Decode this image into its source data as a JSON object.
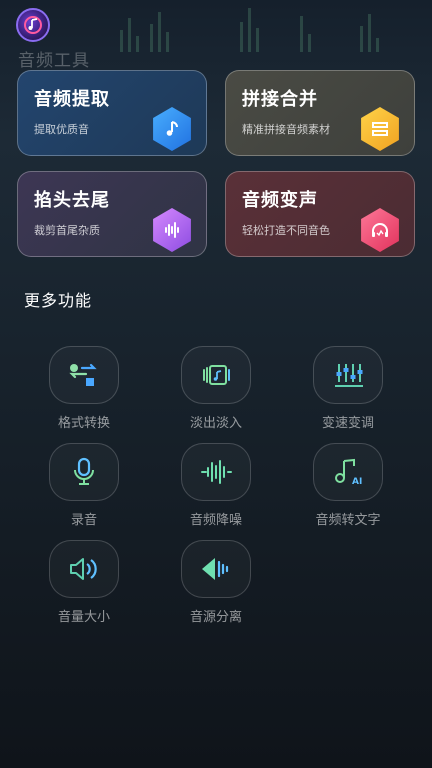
{
  "header": {
    "title": "音频工具",
    "logo_icon": "music-disc-icon"
  },
  "cards": [
    {
      "title": "音频提取",
      "subtitle": "提取优质音",
      "icon": "music-note-icon",
      "color": "#2f8cf0"
    },
    {
      "title": "拼接合并",
      "subtitle": "精准拼接音频素材",
      "icon": "merge-icon",
      "color": "#f5b52e"
    },
    {
      "title": "掐头去尾",
      "subtitle": "裁剪首尾杂质",
      "icon": "waveform-icon",
      "color": "#b070f0"
    },
    {
      "title": "音频变声",
      "subtitle": "轻松打造不同音色",
      "icon": "headphones-icon",
      "color": "#f0507a"
    }
  ],
  "more": {
    "title": "更多功能",
    "tools": [
      {
        "label": "格式转换",
        "icon": "format-convert-icon"
      },
      {
        "label": "淡出淡入",
        "icon": "fade-icon"
      },
      {
        "label": "变速变调",
        "icon": "equalizer-icon"
      },
      {
        "label": "录音",
        "icon": "microphone-icon"
      },
      {
        "label": "音频降噪",
        "icon": "noise-reduction-icon"
      },
      {
        "label": "音频转文字",
        "icon": "audio-to-text-icon"
      },
      {
        "label": "音量大小",
        "icon": "volume-icon"
      },
      {
        "label": "音源分离",
        "icon": "source-separation-icon"
      }
    ]
  },
  "colors": {
    "accent_blue": "#4ab0ff",
    "accent_green": "#7fe0a0",
    "accent_teal": "#5fd0d8"
  }
}
